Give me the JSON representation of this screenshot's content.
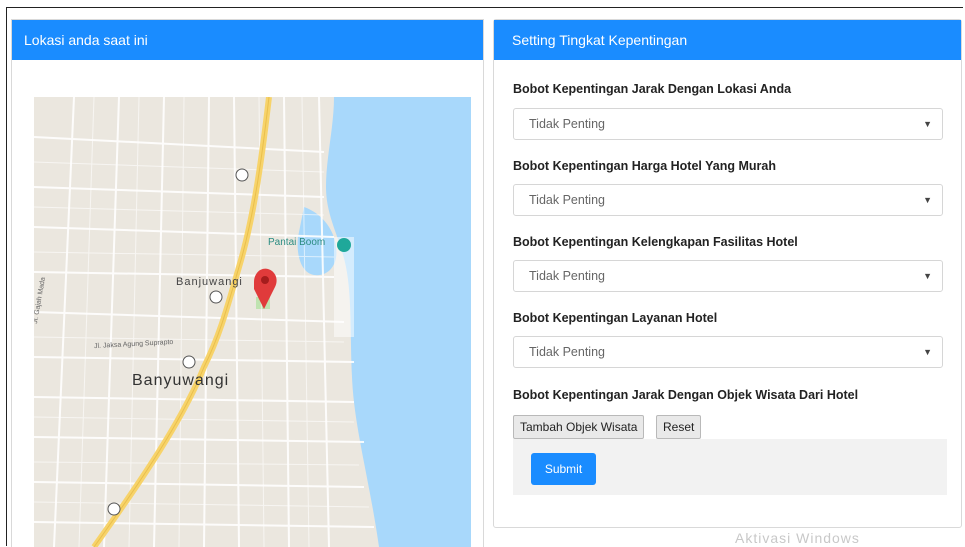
{
  "left_card": {
    "title": "Lokasi anda saat ini",
    "map": {
      "poi_label": "Pantai Boom",
      "city_label_small": "Banjuwangi",
      "city_label_large": "Banyuwangi",
      "street_label": "Jl. Jaksa Agung Suprapto",
      "street_label_left": "Jl. Gajah Mada",
      "route_marker": "①",
      "colors": {
        "land": "#ebe7df",
        "water": "#a8d8fb",
        "highway": "#f7d36a",
        "pin": "#e03b3b"
      }
    }
  },
  "right_card": {
    "title": "Setting Tingkat Kepentingan",
    "fields": [
      {
        "label": "Bobot Kepentingan Jarak Dengan Lokasi Anda",
        "value": "Tidak Penting"
      },
      {
        "label": "Bobot Kepentingan Harga Hotel Yang Murah",
        "value": "Tidak Penting"
      },
      {
        "label": "Bobot Kepentingan Kelengkapan Fasilitas Hotel",
        "value": "Tidak Penting"
      },
      {
        "label": "Bobot Kepentingan Layanan Hotel",
        "value": "Tidak Penting"
      }
    ],
    "objek_label": "Bobot Kepentingan Jarak Dengan Objek Wisata Dari Hotel",
    "add_button": "Tambah Objek Wisata",
    "reset_button": "Reset",
    "submit_button": "Submit",
    "caret": "▼"
  },
  "watermark": "Aktivasi Windows",
  "colors": {
    "accent": "#1a8cff"
  }
}
